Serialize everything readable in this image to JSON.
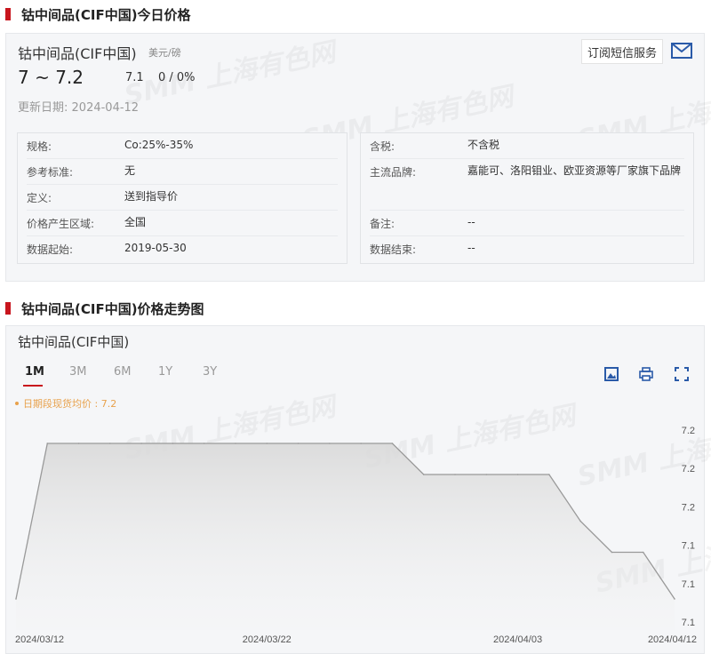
{
  "section1": {
    "title": "钴中间品(CIF中国)今日价格"
  },
  "price": {
    "name": "钴中间品(CIF中国)",
    "unit": "美元/磅",
    "range": "7 ~ 7.2",
    "average": "7.1",
    "change": "0 / 0%",
    "updated_label": "更新日期:",
    "updated_date": "2024-04-12",
    "subscribe_label": "订阅短信服务",
    "subscribe_icon": "mail-icon"
  },
  "specs_left": [
    {
      "label": "规格:",
      "value": "Co:25%-35%"
    },
    {
      "label": "参考标准:",
      "value": "无"
    },
    {
      "label": "定义:",
      "value": "送到指导价"
    },
    {
      "label": "价格产生区域:",
      "value": "全国"
    },
    {
      "label": "数据起始:",
      "value": "2019-05-30"
    }
  ],
  "specs_right": [
    {
      "label": "含税:",
      "value": "不含税"
    },
    {
      "label": "主流品牌:",
      "value": "嘉能可、洛阳钼业、欧亚资源等厂家旗下品牌"
    },
    {
      "label": "备注:",
      "value": "--"
    },
    {
      "label": "数据结束:",
      "value": "--"
    }
  ],
  "section2": {
    "title": "钴中间品(CIF中国)价格走势图"
  },
  "chart_panel": {
    "name": "钴中间品(CIF中国)",
    "tabs": [
      "1M",
      "3M",
      "6M",
      "1Y",
      "3Y"
    ],
    "active_tab": "1M",
    "tools": [
      "download-image-icon",
      "print-icon",
      "fullscreen-icon"
    ],
    "legend": "日期段现货均价 : 7.2"
  },
  "watermark": "SMM 上海有色网",
  "colors": {
    "brand_red": "#c8151d",
    "legend_orange": "#e8a14b",
    "line": "#999999"
  },
  "chart_data": {
    "type": "area",
    "title": "钴中间品(CIF中国)",
    "x_ticks": [
      "2024/03/12",
      "2024/03/22",
      "2024/04/03",
      "2024/04/12"
    ],
    "y_ticks": [
      "7.2",
      "7.2",
      "7.2",
      "7.1",
      "7.1",
      "7.1"
    ],
    "ylim": [
      7.08,
      7.2
    ],
    "series": [
      {
        "name": "日期段现货均价",
        "x": [
          "2024/03/12",
          "2024/03/13",
          "2024/03/14",
          "2024/03/15",
          "2024/03/18",
          "2024/03/19",
          "2024/03/20",
          "2024/03/21",
          "2024/03/22",
          "2024/03/25",
          "2024/03/26",
          "2024/03/27",
          "2024/03/28",
          "2024/03/29",
          "2024/04/01",
          "2024/04/02",
          "2024/04/03",
          "2024/04/08",
          "2024/04/09",
          "2024/04/10",
          "2024/04/11",
          "2024/04/12"
        ],
        "values": [
          7.1,
          7.2,
          7.2,
          7.2,
          7.2,
          7.2,
          7.2,
          7.2,
          7.2,
          7.2,
          7.2,
          7.2,
          7.2,
          7.18,
          7.18,
          7.18,
          7.18,
          7.18,
          7.15,
          7.13,
          7.13,
          7.1
        ]
      }
    ],
    "grid": false,
    "legend_position": "top-left"
  }
}
